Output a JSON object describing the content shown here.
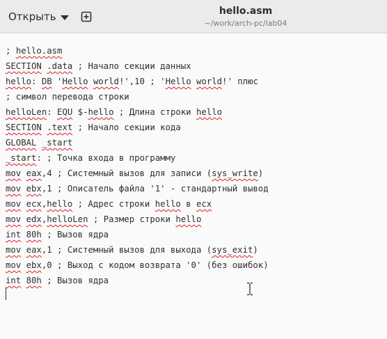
{
  "header": {
    "open_label": "Открыть",
    "title": "hello.asm",
    "path": "~/work/arch-pc/lab04"
  },
  "icons": {
    "open_dropdown": "chevron-down-icon",
    "new_document": "new-document-icon",
    "mouse_pointer": "ibeam-cursor-icon"
  },
  "colors": {
    "headerbar": "#ebebeb",
    "editor_bg": "#fafafa",
    "text": "#2e2e2e",
    "spell_underline": "#e01b24"
  },
  "code_lines": [
    [
      {
        "t": "; "
      },
      {
        "t": "hello.asm",
        "s": true
      }
    ],
    [
      {
        "t": "SECTION",
        "s": true
      },
      {
        "t": " "
      },
      {
        "t": ".data",
        "s": true
      },
      {
        "t": " ; Начало секции данных"
      }
    ],
    [
      {
        "t": "hello",
        "s": true
      },
      {
        "t": ": "
      },
      {
        "t": "DB",
        "s": true
      },
      {
        "t": " '"
      },
      {
        "t": "Hello",
        "s": true
      },
      {
        "t": " "
      },
      {
        "t": "world",
        "s": true
      },
      {
        "t": "!',10 ; '"
      },
      {
        "t": "Hello",
        "s": true
      },
      {
        "t": " "
      },
      {
        "t": "world",
        "s": true
      },
      {
        "t": "!' плюс"
      }
    ],
    [
      {
        "t": "; символ перевода строки"
      }
    ],
    [
      {
        "t": "helloLen",
        "s": true
      },
      {
        "t": ": "
      },
      {
        "t": "EQU",
        "s": true
      },
      {
        "t": " $-"
      },
      {
        "t": "hello",
        "s": true
      },
      {
        "t": " ; Длина строки "
      },
      {
        "t": "hello",
        "s": true
      }
    ],
    [
      {
        "t": "SECTION",
        "s": true
      },
      {
        "t": " "
      },
      {
        "t": ".text",
        "s": true
      },
      {
        "t": " ; Начало секции кода"
      }
    ],
    [
      {
        "t": "GLOBAL",
        "s": true
      },
      {
        "t": " "
      },
      {
        "t": "_start",
        "s": true
      }
    ],
    [
      {
        "t": "_start",
        "s": true
      },
      {
        "t": ": ; Точка входа в программу"
      }
    ],
    [
      {
        "t": "mov",
        "s": true
      },
      {
        "t": " "
      },
      {
        "t": "eax",
        "s": true
      },
      {
        "t": ",4 ; Системный вызов для записи ("
      },
      {
        "t": "sys_write",
        "s": true
      },
      {
        "t": ")"
      }
    ],
    [
      {
        "t": "mov",
        "s": true
      },
      {
        "t": " "
      },
      {
        "t": "ebx",
        "s": true
      },
      {
        "t": ",1 ; Описатель файла '1' - стандартный вывод"
      }
    ],
    [
      {
        "t": "mov",
        "s": true
      },
      {
        "t": " "
      },
      {
        "t": "ecx",
        "s": true
      },
      {
        "t": ","
      },
      {
        "t": "hello",
        "s": true
      },
      {
        "t": " ; Адрес строки "
      },
      {
        "t": "hello",
        "s": true
      },
      {
        "t": " в "
      },
      {
        "t": "ecx",
        "s": true
      }
    ],
    [
      {
        "t": "mov",
        "s": true
      },
      {
        "t": " "
      },
      {
        "t": "edx",
        "s": true
      },
      {
        "t": ","
      },
      {
        "t": "helloLen",
        "s": true
      },
      {
        "t": " ; Размер строки "
      },
      {
        "t": "hello",
        "s": true
      }
    ],
    [
      {
        "t": "int",
        "s": true
      },
      {
        "t": " "
      },
      {
        "t": "80h",
        "s": true
      },
      {
        "t": " ; Вызов ядра"
      }
    ],
    [
      {
        "t": "mov",
        "s": true
      },
      {
        "t": " "
      },
      {
        "t": "eax",
        "s": true
      },
      {
        "t": ",1 ; Системный вызов для выхода ("
      },
      {
        "t": "sys_exit",
        "s": true
      },
      {
        "t": ")"
      }
    ],
    [
      {
        "t": "mov",
        "s": true
      },
      {
        "t": " "
      },
      {
        "t": "ebx",
        "s": true
      },
      {
        "t": ",0 ; Выход с кодом возврата '0' (без ошибок)"
      }
    ],
    [
      {
        "t": "int",
        "s": true
      },
      {
        "t": " "
      },
      {
        "t": "80h",
        "s": true
      },
      {
        "t": " ; Вызов ядра"
      }
    ]
  ]
}
